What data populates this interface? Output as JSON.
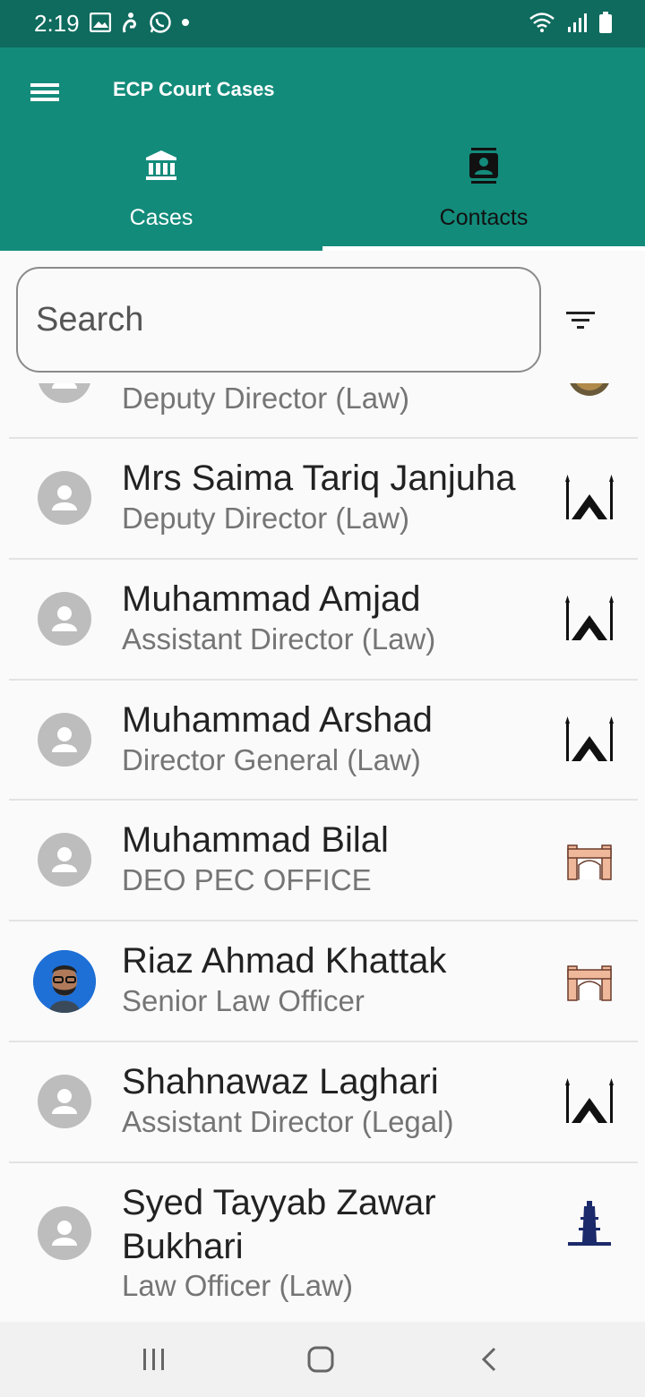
{
  "status_bar": {
    "time": "2:19",
    "icons_left": [
      "gallery-icon",
      "accessibility-icon",
      "whatsapp-icon",
      "dot-icon"
    ],
    "icons_right": [
      "wifi-icon",
      "signal-icon",
      "battery-icon"
    ]
  },
  "app_bar": {
    "title": "ECP Court Cases",
    "menu_icon": "menu-icon",
    "background_color": "#138b7b",
    "status_color": "#0e6b5e"
  },
  "tabs": [
    {
      "label": "Cases",
      "icon": "bank-icon",
      "selected": false
    },
    {
      "label": "Contacts",
      "icon": "contact-card-icon",
      "selected": true
    }
  ],
  "search": {
    "placeholder": "Search",
    "value": ""
  },
  "filter": {
    "icon": "filter-icon"
  },
  "contacts": [
    {
      "name": "",
      "role": "Deputy Director (Law)",
      "avatar": "person-icon",
      "badge": "round-badge-icon"
    },
    {
      "name": "Mrs Saima Tariq Janjuha",
      "role": "Deputy Director (Law)",
      "avatar": "person-icon",
      "badge": "faisal-mosque-icon"
    },
    {
      "name": "Muhammad Amjad",
      "role": "Assistant Director (Law)",
      "avatar": "person-icon",
      "badge": "faisal-mosque-icon"
    },
    {
      "name": "Muhammad Arshad",
      "role": "Director General (Law)",
      "avatar": "person-icon",
      "badge": "faisal-mosque-icon"
    },
    {
      "name": "Muhammad Bilal",
      "role": "DEO PEC OFFICE",
      "avatar": "person-icon",
      "badge": "fort-gate-icon"
    },
    {
      "name": "Riaz Ahmad Khattak",
      "role": "Senior Law Officer",
      "avatar": "photo-avatar",
      "badge": "fort-gate-icon"
    },
    {
      "name": "Shahnawaz Laghari",
      "role": "Assistant Director (Legal)",
      "avatar": "person-icon",
      "badge": "faisal-mosque-icon"
    },
    {
      "name": "Syed Tayyab Zawar Bukhari",
      "role": "Law Officer (Law)",
      "avatar": "person-icon",
      "badge": "minar-icon"
    }
  ],
  "nav_bar": {
    "buttons": [
      "recents-icon",
      "home-icon",
      "back-icon"
    ]
  }
}
